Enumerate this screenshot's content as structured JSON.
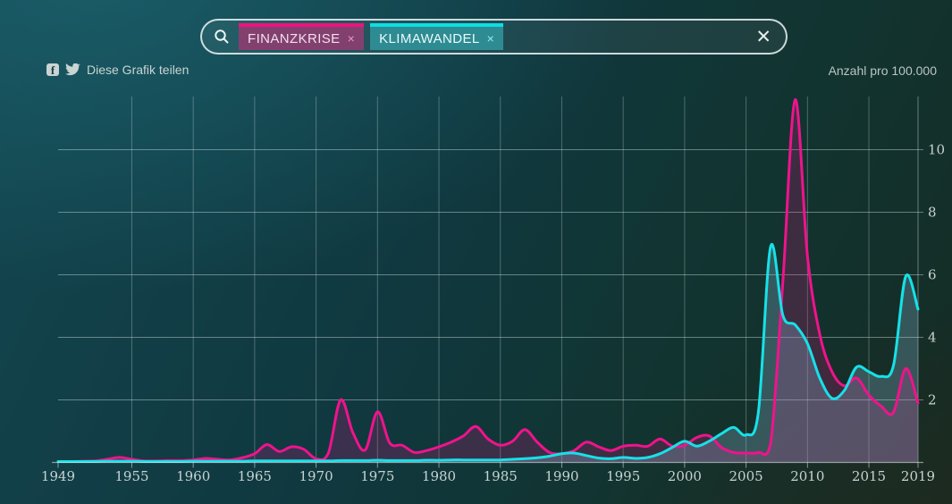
{
  "search": {
    "clear_glyph": "✕",
    "placeholder": "",
    "value": "",
    "tags": [
      {
        "label": "FINANZKRISE",
        "remove_glyph": "×",
        "accent": "#f0127f",
        "bg": "#82406f",
        "text_color": "#f3dfeb",
        "x_color": "#ef93c3"
      },
      {
        "label": "KLIMAWANDEL",
        "remove_glyph": "×",
        "accent": "#0bdfe4",
        "bg": "#2e8b92",
        "text_color": "#eafbfb",
        "x_color": "#8fecef"
      }
    ]
  },
  "share": {
    "label": "Diese Grafik teilen",
    "facebook_glyph": "f"
  },
  "unit_label": "Anzahl pro 100.000",
  "chart_data": {
    "type": "line",
    "title": "",
    "xlabel": "",
    "ylabel": "Anzahl pro 100.000",
    "xlim": [
      1949,
      2019
    ],
    "ylim": [
      0,
      11.9
    ],
    "grid": true,
    "legend_position": "none",
    "x_ticks": [
      1949,
      1955,
      1960,
      1965,
      1970,
      1975,
      1980,
      1985,
      1990,
      1995,
      2000,
      2005,
      2010,
      2015,
      2019
    ],
    "grid_years": [
      1955,
      1960,
      1965,
      1970,
      1975,
      1980,
      1985,
      1990,
      1995,
      2000,
      2005,
      2010,
      2015
    ],
    "y_ticks": [
      2,
      4,
      6,
      8,
      10
    ],
    "x": [
      1949,
      1950,
      1951,
      1952,
      1953,
      1954,
      1955,
      1956,
      1957,
      1958,
      1959,
      1960,
      1961,
      1962,
      1963,
      1964,
      1965,
      1966,
      1967,
      1968,
      1969,
      1970,
      1971,
      1972,
      1973,
      1974,
      1975,
      1976,
      1977,
      1978,
      1979,
      1980,
      1981,
      1982,
      1983,
      1984,
      1985,
      1986,
      1987,
      1988,
      1989,
      1990,
      1991,
      1992,
      1993,
      1994,
      1995,
      1996,
      1997,
      1998,
      1999,
      2000,
      2001,
      2002,
      2003,
      2004,
      2005,
      2006,
      2007,
      2008,
      2009,
      2010,
      2011,
      2012,
      2013,
      2014,
      2015,
      2016,
      2017,
      2018,
      2019
    ],
    "series": [
      {
        "name": "FINANZKRISE",
        "color": "#f0138c",
        "fill": "rgba(236,18,140,0.20)",
        "values": [
          0.03,
          0.03,
          0.04,
          0.05,
          0.1,
          0.16,
          0.1,
          0.05,
          0.05,
          0.06,
          0.06,
          0.08,
          0.13,
          0.1,
          0.08,
          0.15,
          0.28,
          0.57,
          0.35,
          0.5,
          0.42,
          0.12,
          0.3,
          2.0,
          0.95,
          0.4,
          1.62,
          0.62,
          0.55,
          0.32,
          0.38,
          0.5,
          0.65,
          0.85,
          1.15,
          0.75,
          0.55,
          0.68,
          1.05,
          0.65,
          0.32,
          0.28,
          0.38,
          0.65,
          0.5,
          0.38,
          0.52,
          0.55,
          0.52,
          0.75,
          0.52,
          0.55,
          0.8,
          0.85,
          0.48,
          0.32,
          0.3,
          0.32,
          0.6,
          5.8,
          11.6,
          6.6,
          4.1,
          2.9,
          2.45,
          2.7,
          2.15,
          1.8,
          1.6,
          3.0,
          1.9
        ]
      },
      {
        "name": "KLIMAWANDEL",
        "color": "#16e1e8",
        "fill": "rgba(150,205,235,0.26)",
        "values": [
          0.03,
          0.03,
          0.03,
          0.03,
          0.04,
          0.04,
          0.04,
          0.03,
          0.03,
          0.03,
          0.03,
          0.04,
          0.04,
          0.04,
          0.04,
          0.04,
          0.05,
          0.05,
          0.05,
          0.05,
          0.05,
          0.05,
          0.05,
          0.06,
          0.06,
          0.06,
          0.07,
          0.06,
          0.06,
          0.06,
          0.07,
          0.07,
          0.08,
          0.08,
          0.08,
          0.08,
          0.08,
          0.1,
          0.12,
          0.15,
          0.2,
          0.28,
          0.3,
          0.22,
          0.14,
          0.12,
          0.16,
          0.13,
          0.16,
          0.28,
          0.48,
          0.68,
          0.52,
          0.68,
          0.92,
          1.12,
          0.88,
          1.6,
          6.9,
          4.7,
          4.4,
          3.8,
          2.7,
          2.05,
          2.3,
          3.05,
          2.9,
          2.75,
          3.1,
          5.95,
          4.9
        ]
      }
    ]
  }
}
